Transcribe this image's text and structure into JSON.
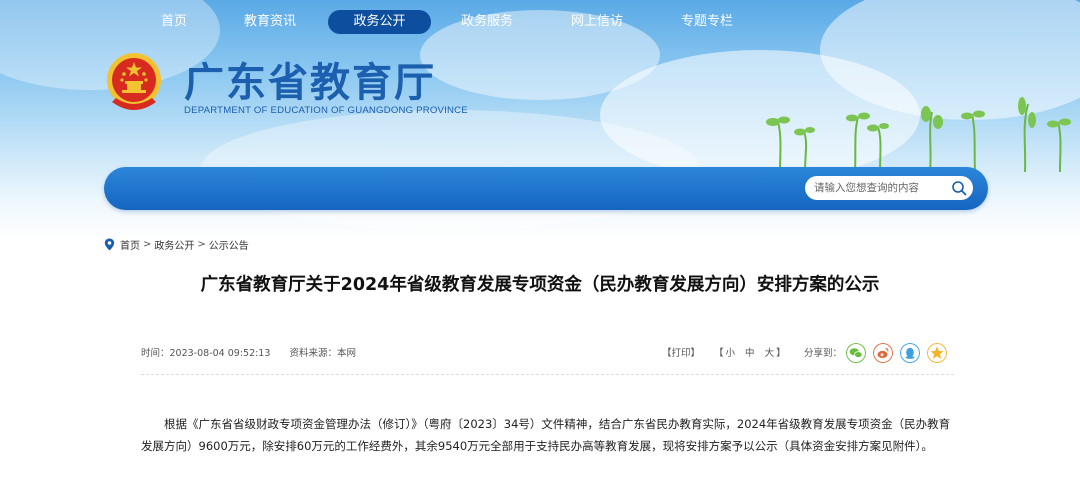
{
  "header": {
    "title": "广东省教育厅",
    "subtitle": "DEPARTMENT OF EDUCATION OF GUANGDONG PROVINCE"
  },
  "nav": {
    "items": [
      {
        "label": "首页"
      },
      {
        "label": "教育资讯"
      },
      {
        "label": "政务公开",
        "active": true
      },
      {
        "label": "政务服务"
      },
      {
        "label": "网上信访"
      },
      {
        "label": "专题专栏"
      }
    ],
    "search": {
      "placeholder": "请输入您想查询的内容"
    }
  },
  "breadcrumb": {
    "items": [
      "首页",
      "政务公开",
      "公示公告"
    ],
    "separator": ">"
  },
  "article": {
    "title": "广东省教育厅关于2024年省级教育发展专项资金（民办教育发展方向）安排方案的公示",
    "time": "时间：2023-08-04 09:52:13",
    "source": "资料来源：本网",
    "print": "【打印】",
    "font_open": "【",
    "font_small": "小",
    "font_medium": "中",
    "font_large": "大",
    "font_close": "】",
    "share_label": "分享到：",
    "body": "根据《广东省省级财政专项资金管理办法（修订）》（粤府〔2023〕34号）文件精神，结合广东省民办教育实际，2024年省级教育发展专项资金（民办教育发展方向）9600万元，除安排60万元的工作经费外，其余9540万元全部用于支持民办高等教育发展，现将安排方案予以公示（具体资金安排方案见附件）。"
  },
  "share_icons": [
    "wechat-icon",
    "weibo-icon",
    "qq-icon",
    "qzone-icon"
  ],
  "colors": {
    "brand_blue": "#1b5fae",
    "nav_blue": "#1565c0",
    "nav_active": "#0d4f9e",
    "wechat": "#67bd3c",
    "weibo": "#e0693b",
    "qq": "#3aa0e0",
    "qzone": "#f5b32a"
  }
}
